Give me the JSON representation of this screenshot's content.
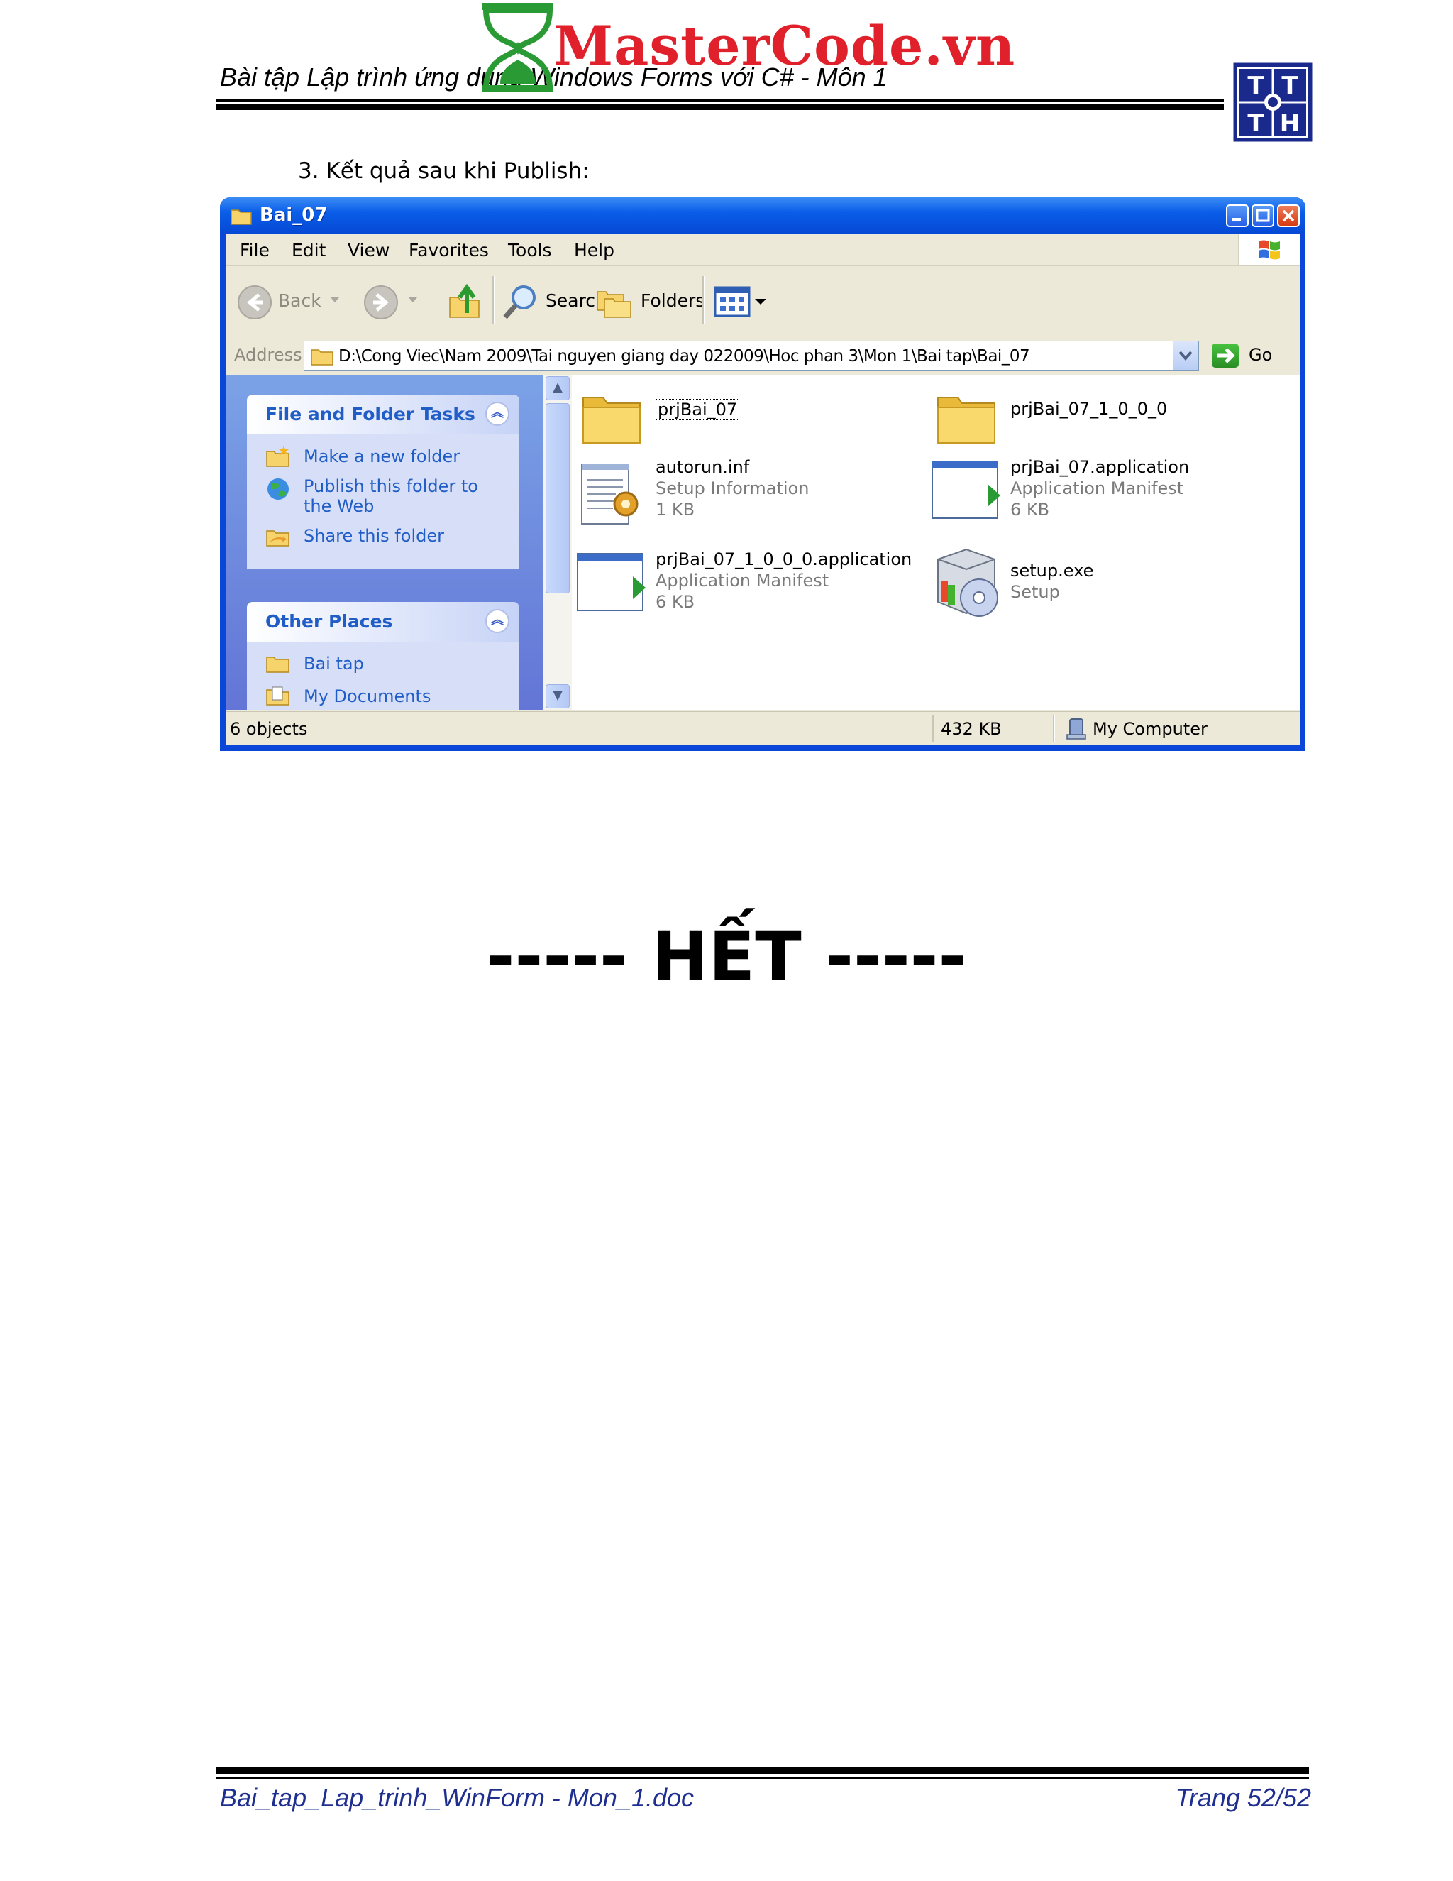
{
  "header": {
    "title": "Bài tập Lập trình ứng dụng Windows Forms với C# - Môn 1",
    "logo_text": "MasterCode.vn",
    "badge_letters": [
      "T",
      "T",
      "T",
      "H"
    ]
  },
  "step": {
    "label": "3.   Kết quả sau khi Publish:"
  },
  "window": {
    "title": "Bai_07",
    "menu": [
      "File",
      "Edit",
      "View",
      "Favorites",
      "Tools",
      "Help"
    ],
    "toolbar": {
      "back": "Back",
      "search": "Search",
      "folders": "Folders"
    },
    "address": {
      "label": "Address",
      "path": "D:\\Cong Viec\\Nam 2009\\Tai nguyen giang day 022009\\Hoc phan 3\\Mon 1\\Bai tap\\Bai_07",
      "go": "Go"
    },
    "tasks": {
      "title": "File and Folder Tasks",
      "items": [
        "Make a new folder",
        "Publish this folder to",
        "the Web",
        "Share this folder"
      ]
    },
    "places": {
      "title": "Other Places",
      "items": [
        "Bai tap",
        "My Documents"
      ]
    },
    "files": [
      {
        "name": "prjBai_07",
        "type": "",
        "size": "",
        "icon": "folder-icon"
      },
      {
        "name": "prjBai_07_1_0_0_0",
        "type": "",
        "size": "",
        "icon": "folder-icon"
      },
      {
        "name": "autorun.inf",
        "type": "Setup Information",
        "size": "1 KB",
        "icon": "setup-info-icon"
      },
      {
        "name": "prjBai_07.application",
        "type": "Application Manifest",
        "size": "6 KB",
        "icon": "manifest-icon"
      },
      {
        "name": "prjBai_07_1_0_0_0.application",
        "type": "Application Manifest",
        "size": "6 KB",
        "icon": "manifest-icon"
      },
      {
        "name": "setup.exe",
        "type": "Setup",
        "size": "",
        "icon": "setup-exe-icon"
      }
    ],
    "status": {
      "objects": "6 objects",
      "size": "432 KB",
      "zone": "My Computer"
    }
  },
  "end_marker": "----- HẾT -----",
  "footer": {
    "filename": "Bai_tap_Lap_trinh_WinForm - Mon_1.doc",
    "page": "Trang 52/52"
  },
  "colors": {
    "titlebar": "#0a5ee8",
    "task_link": "#215dc6",
    "logo": "#e0202a"
  }
}
